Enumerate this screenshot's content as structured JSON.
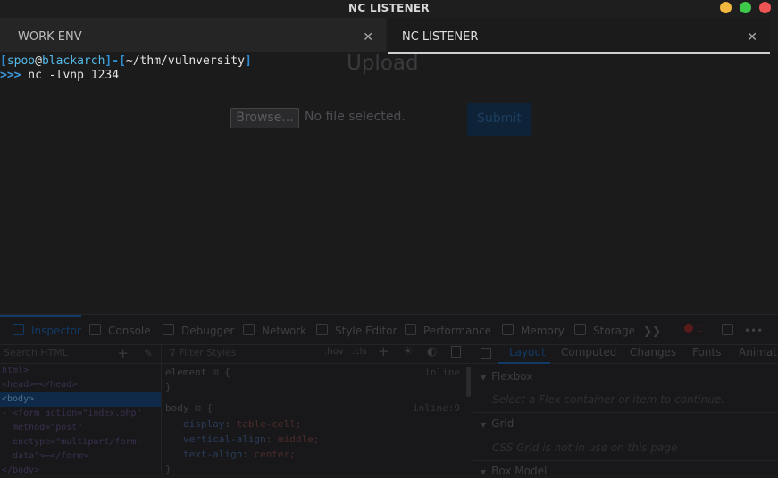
{
  "window": {
    "title": "NC LISTENER"
  },
  "tabs": [
    {
      "label": "WORK ENV",
      "close": "✕"
    },
    {
      "label": "NC LISTENER",
      "close": "✕"
    }
  ],
  "page": {
    "title": "Upload",
    "browse_label": "Browse...",
    "no_file_label": "No file selected.",
    "submit_label": "Submit"
  },
  "terminal": {
    "prompt_bracket_open": "[",
    "prompt_user": "spoo",
    "prompt_at": "@",
    "prompt_host": "blackarch",
    "prompt_close_bracket": "]-[",
    "prompt_path": "~/thm/vulnversity",
    "prompt_end": "]",
    "cmd_prefix": ">>>",
    "command": " nc -lvnp 1234"
  },
  "devtools": {
    "tabs": [
      "Inspector",
      "Console",
      "Debugger",
      "Network",
      "Style Editor",
      "Performance",
      "Memory",
      "Storage"
    ],
    "more": "❯❯",
    "error_count": "1",
    "menu": "•••",
    "html_panel": {
      "search_placeholder": "Search HTML",
      "plus": "+",
      "lines": [
        {
          "text": "html>"
        },
        {
          "text": "<head>"
        },
        {
          "text": "<body>"
        },
        {
          "text": "<form action=\"index.php\""
        },
        {
          "text": "  method=\"post\""
        },
        {
          "text": "  enctype=\"multipart/form-"
        },
        {
          "text": "  data\">⋯</form>"
        },
        {
          "text": "</body>"
        }
      ],
      "head_ellipsis": "⋯",
      "head_close": "</head>"
    },
    "rules_panel": {
      "filter_placeholder": "Filter Styles",
      "hov": ":hov",
      "cls": ".cls",
      "plus": "+",
      "element_rule": "element",
      "element_src": "inline",
      "open_brace": "{",
      "close_brace": "}",
      "body_rule": "body",
      "body_src": "inline:9",
      "declarations": [
        {
          "prop": "display",
          "value": "table-cell;"
        },
        {
          "prop": "vertical-align",
          "value": "middle;"
        },
        {
          "prop": "text-align",
          "value": "center;"
        }
      ]
    },
    "layout_panel": {
      "tabs": [
        "Layout",
        "Computed",
        "Changes",
        "Fonts",
        "Animati"
      ],
      "sections": [
        {
          "title": "Flexbox",
          "message": "Select a Flex container or item to continue."
        },
        {
          "title": "Grid",
          "message": "CSS Grid is not in use on this page"
        },
        {
          "title": "Box Model",
          "message": ""
        }
      ]
    }
  }
}
